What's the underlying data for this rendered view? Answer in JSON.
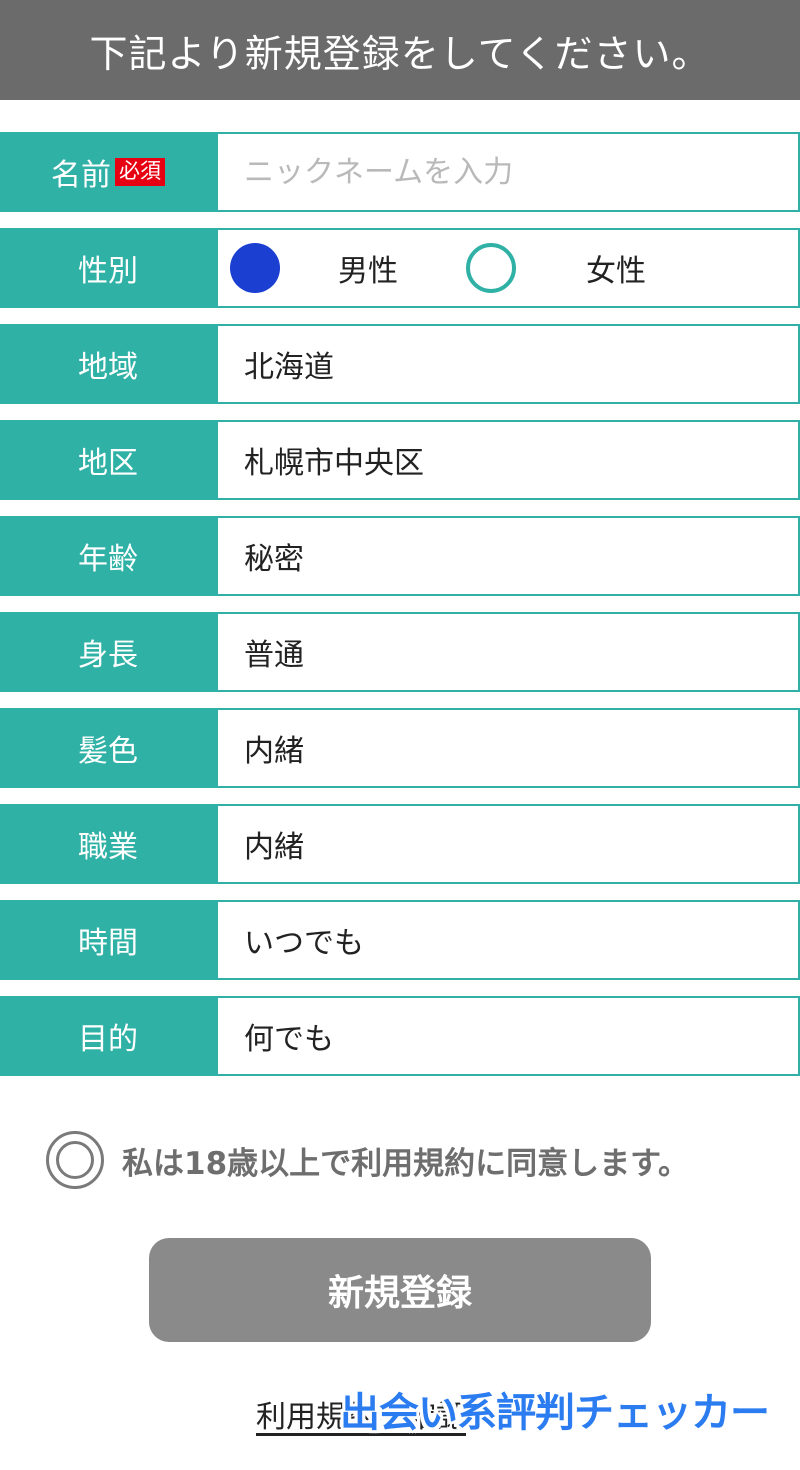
{
  "header": {
    "title": "下記より新規登録をしてください。"
  },
  "form": {
    "name": {
      "label": "名前",
      "required_badge": "必須",
      "placeholder": "ニックネームを入力",
      "value": ""
    },
    "gender": {
      "label": "性別",
      "options": [
        {
          "label": "男性",
          "selected": true
        },
        {
          "label": "女性",
          "selected": false
        }
      ]
    },
    "region": {
      "label": "地域",
      "value": "北海道"
    },
    "district": {
      "label": "地区",
      "value": "札幌市中央区"
    },
    "age": {
      "label": "年齢",
      "value": "秘密"
    },
    "height": {
      "label": "身長",
      "value": "普通"
    },
    "hair_color": {
      "label": "髪色",
      "value": "内緒"
    },
    "occupation": {
      "label": "職業",
      "value": "内緒"
    },
    "time": {
      "label": "時間",
      "value": "いつでも"
    },
    "purpose": {
      "label": "目的",
      "value": "何でも"
    }
  },
  "agreement": {
    "text": "私は18歳以上で利用規約に同意します。"
  },
  "submit_label": "新規登録",
  "terms_link": "利用規約を確認",
  "watermark": "出会い系評判チェッカー",
  "colors": {
    "header_bg": "#6b6b6b",
    "label_bg": "#2fb1a5",
    "required_badge": "#e60012",
    "radio_selected": "#1a3fd1",
    "submit_bg": "#8a8a8a",
    "watermark": "#2a7cf0"
  }
}
